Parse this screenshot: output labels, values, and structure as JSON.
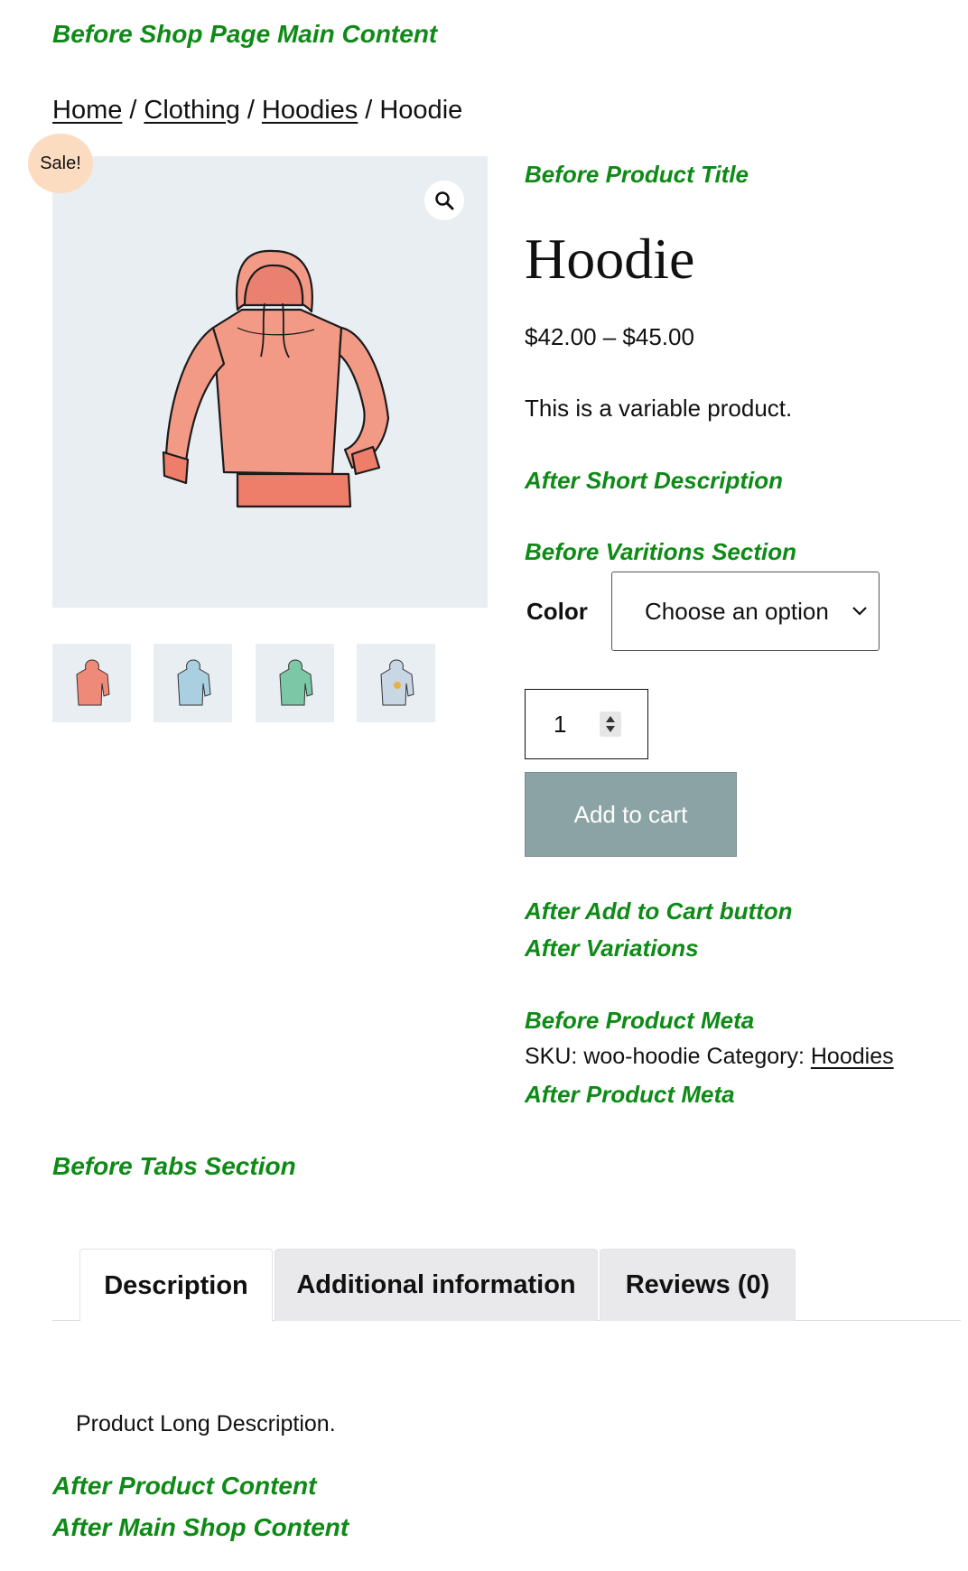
{
  "hooks": {
    "before_main": "Before Shop Page Main Content",
    "before_title": "Before Product Title",
    "after_short_desc": "After Short Description",
    "before_variations": "Before Varitions Section",
    "after_add_to_cart": "After Add to Cart button",
    "after_variations": "After Variations",
    "before_meta": "Before Product Meta",
    "after_meta": "After Product Meta",
    "before_tabs": "Before Tabs Section",
    "after_product_content": "After Product Content",
    "after_main": "After Main Shop Content"
  },
  "breadcrumb": {
    "items": [
      "Home",
      "Clothing",
      "Hoodies"
    ],
    "separator": "/",
    "current": "Hoodie"
  },
  "gallery": {
    "sale_badge": "Sale!",
    "zoom_icon": "magnifier-icon",
    "thumbnail_colors": [
      "#f08a78",
      "#a9cfe0",
      "#7cc7a6",
      "#c9d6e4"
    ]
  },
  "product": {
    "title": "Hoodie",
    "price": "$42.00 – $45.00",
    "short_description": "This is a variable product.",
    "variation": {
      "label": "Color",
      "selected": "Choose an option"
    },
    "quantity": "1",
    "add_to_cart": "Add to cart",
    "meta": {
      "sku_label": "SKU:",
      "sku": "woo-hoodie",
      "category_label": "Category:",
      "category": "Hoodies"
    }
  },
  "tabs": [
    {
      "label": "Description",
      "active": true
    },
    {
      "label": "Additional information",
      "active": false
    },
    {
      "label": "Reviews (0)",
      "active": false
    }
  ],
  "long_description": "Product Long Description.",
  "colors": {
    "hook_green": "#0e8a16",
    "button": "#8ca3a6",
    "gallery_bg": "#e9eef2",
    "sale_badge": "#fbdcc1"
  }
}
